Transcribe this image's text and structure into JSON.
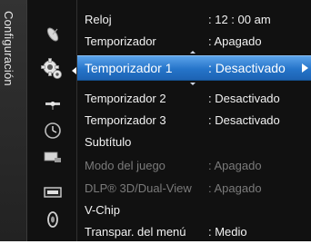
{
  "sidebar": {
    "title": "Configuración"
  },
  "categories": [
    {
      "icon": "satellite-dish-icon",
      "active": false
    },
    {
      "icon": "gear-icon",
      "active": true
    },
    {
      "icon": "satellite-icon",
      "active": false
    },
    {
      "icon": "clock-icon",
      "active": false
    },
    {
      "icon": "input-source-icon",
      "active": false
    },
    {
      "icon": "screen-icon",
      "active": false
    },
    {
      "icon": "speaker-icon",
      "active": false
    }
  ],
  "menu": {
    "items": [
      {
        "label": "Reloj",
        "value": ": 12 : 00 am"
      },
      {
        "label": "Temporizador",
        "value": ": Apagado"
      },
      {
        "label": "Temporizador 1",
        "value": ": Desactivado"
      },
      {
        "label": "Temporizador 2",
        "value": ": Desactivado"
      },
      {
        "label": "Temporizador 3",
        "value": ": Desactivado"
      },
      {
        "label": "Subtítulo",
        "value": ""
      },
      {
        "label": "Modo del juego",
        "value": ": Apagado"
      },
      {
        "label": "DLP® 3D/Dual-View",
        "value": ": Apagado"
      },
      {
        "label": "V-Chip",
        "value": ""
      },
      {
        "label": "Transpar. del menú",
        "value": ": Medio"
      }
    ]
  },
  "colors": {
    "highlight": "#2574c9",
    "background": "#111111",
    "text": "#f2f2f2",
    "disabled_text": "#7a7a7a"
  }
}
